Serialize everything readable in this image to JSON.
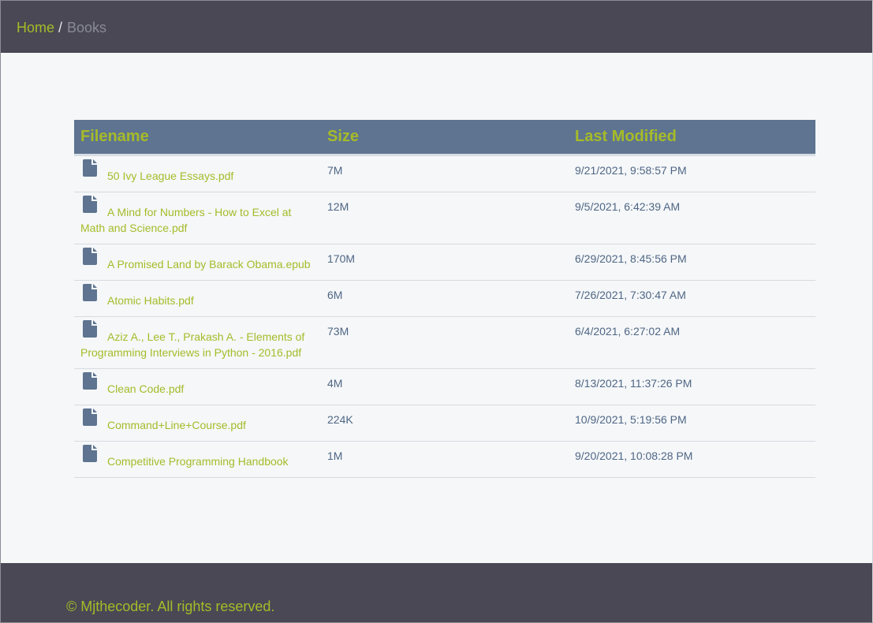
{
  "breadcrumb": {
    "home_label": "Home",
    "separator": "/",
    "current_label": "Books"
  },
  "table": {
    "headers": {
      "filename": "Filename",
      "size": "Size",
      "last_modified": "Last Modified"
    },
    "rows": [
      {
        "icon": "file-icon",
        "name": "50 Ivy League Essays.pdf",
        "size": "7M",
        "modified": "9/21/2021, 9:58:57 PM"
      },
      {
        "icon": "file-icon",
        "name": "A Mind for Numbers - How to Excel at Math and Science.pdf",
        "size": "12M",
        "modified": "9/5/2021, 6:42:39 AM"
      },
      {
        "icon": "file-icon",
        "name": "A Promised Land by Barack Obama.epub",
        "size": "170M",
        "modified": "6/29/2021, 8:45:56 PM"
      },
      {
        "icon": "file-icon",
        "name": "Atomic Habits.pdf",
        "size": "6M",
        "modified": "7/26/2021, 7:30:47 AM"
      },
      {
        "icon": "file-icon",
        "name": "Aziz A., Lee T., Prakash A. - Elements of Programming Interviews in Python - 2016.pdf",
        "size": "73M",
        "modified": "6/4/2021, 6:27:02 AM"
      },
      {
        "icon": "file-icon",
        "name": "Clean Code.pdf",
        "size": "4M",
        "modified": "8/13/2021, 11:37:26 PM"
      },
      {
        "icon": "file-icon",
        "name": "Command+Line+Course.pdf",
        "size": "224K",
        "modified": "10/9/2021, 5:19:56 PM"
      },
      {
        "icon": "file-icon",
        "name": "Competitive Programming Handbook",
        "size": "1M",
        "modified": "9/20/2021, 10:08:28 PM"
      }
    ]
  },
  "footer": {
    "copyright": "© Mjthecoder. All rights reserved."
  },
  "colors": {
    "header_bg": "#494854",
    "accent": "#a6bb28",
    "table_header_bg": "#5e7490",
    "text": "#4f6684",
    "page_bg": "#f5f7f9"
  }
}
